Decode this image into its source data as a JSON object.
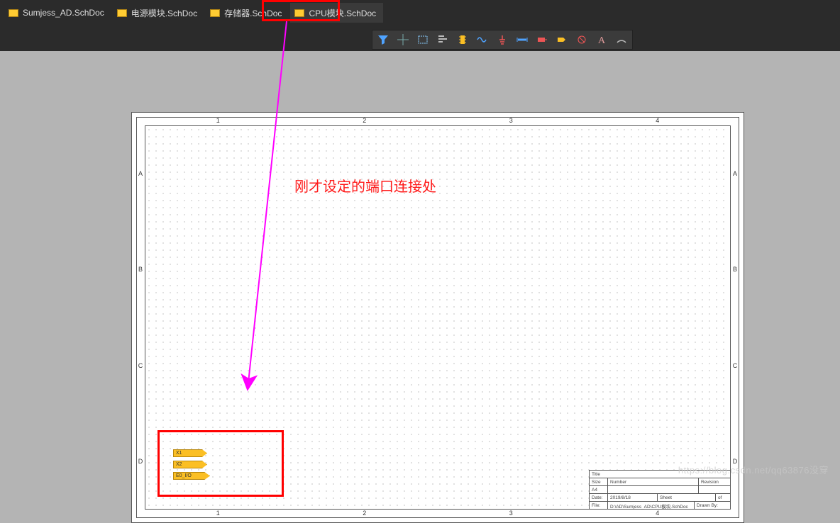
{
  "tabs": [
    {
      "label": "Sumjess_AD.SchDoc",
      "active": false
    },
    {
      "label": "电源模块.SchDoc",
      "active": false
    },
    {
      "label": "存储器.SchDoc",
      "active": false
    },
    {
      "label": "CPU模块.SchDoc",
      "active": true
    }
  ],
  "toolbar_icons": [
    "filter-icon",
    "crosshair-icon",
    "rectangle-icon",
    "align-icon",
    "ic-icon",
    "wave-icon",
    "gnd-icon",
    "bus-icon",
    "net-icon",
    "port-icon",
    "noerc-icon",
    "text-icon",
    "arc-icon"
  ],
  "ruler": {
    "cols": [
      "1",
      "2",
      "3",
      "4"
    ],
    "rows": [
      "A",
      "B",
      "C",
      "D"
    ]
  },
  "ports": [
    {
      "label": "X1"
    },
    {
      "label": "X2"
    },
    {
      "label": "E0_I/O"
    }
  ],
  "titleblock": {
    "title_label": "Title",
    "size_label": "Size",
    "size_value": "A4",
    "number_label": "Number",
    "revision_label": "Revision",
    "date_label": "Date:",
    "date_value": "2019/8/18",
    "sheet_label": "Sheet",
    "of_label": "of",
    "file_label": "File:",
    "file_value": "D:\\AD\\Sumjess_AD\\CPU模块.SchDoc",
    "drawn_label": "Drawn By:"
  },
  "annotation": {
    "text": "刚才设定的端口连接处"
  },
  "watermark": "https://blog.csdn.net/qq63876没穿",
  "highlight_tab_index": 3
}
